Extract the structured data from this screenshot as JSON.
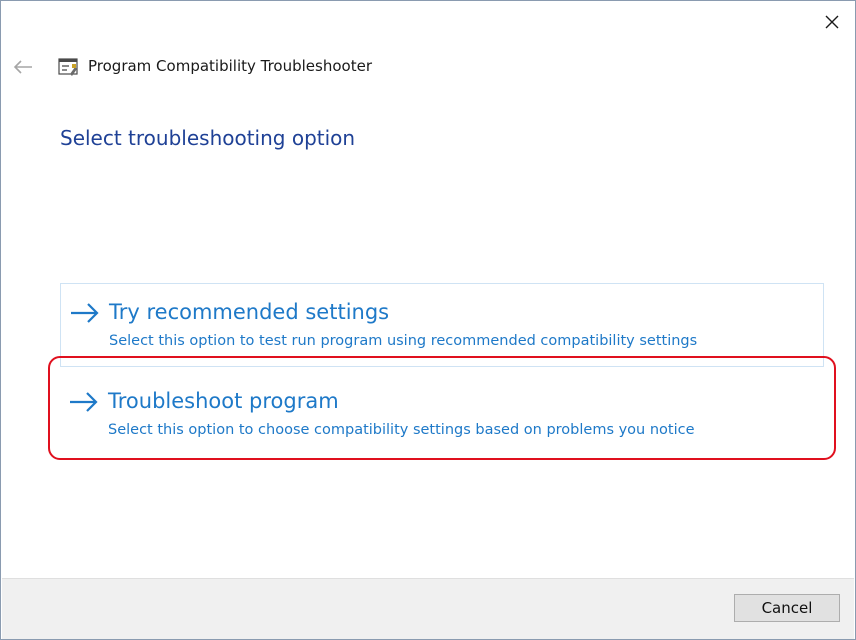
{
  "window": {
    "title": "Program Compatibility Troubleshooter",
    "back_icon": "back-arrow-icon",
    "close_icon": "close-icon",
    "app_icon": "troubleshooter-app-icon"
  },
  "main": {
    "heading": "Select troubleshooting option",
    "options": [
      {
        "title": "Try recommended settings",
        "description": "Select this option to test run program using recommended compatibility settings",
        "icon": "right-arrow-icon"
      },
      {
        "title": "Troubleshoot program",
        "description": "Select this option to choose compatibility settings based on problems you notice",
        "icon": "right-arrow-icon",
        "highlighted": true
      }
    ]
  },
  "footer": {
    "cancel_label": "Cancel"
  },
  "colors": {
    "heading": "#1f4196",
    "link": "#1e79c8",
    "highlight": "#e0101e",
    "footer_bg": "#f0f0f0"
  }
}
